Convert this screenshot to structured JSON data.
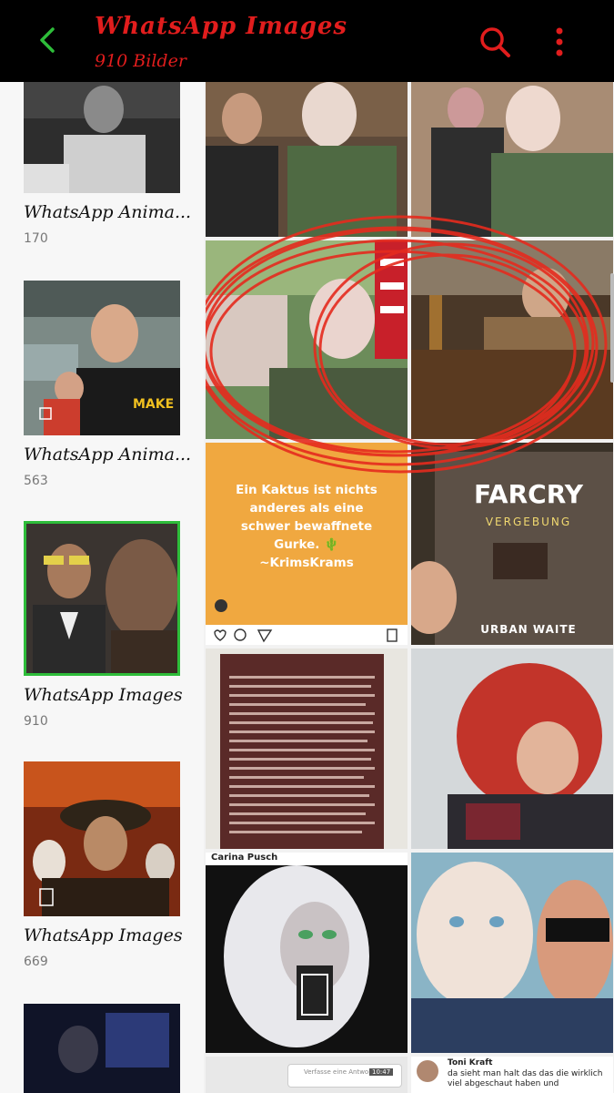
{
  "header": {
    "title": "WhatsApp Images",
    "subtitle": "910 Bilder",
    "accent_color": "#e11d1d"
  },
  "albums": [
    {
      "name": "WhatsApp Anima...",
      "count": "170"
    },
    {
      "name": "WhatsApp Anima...",
      "count": "563"
    },
    {
      "name": "WhatsApp Images",
      "count": "910"
    },
    {
      "name": "WhatsApp Images",
      "count": "669"
    }
  ],
  "grid": {
    "kaktus_text": "Ein Kaktus ist nichts anderes als eine schwer bewaffnete Gurke. 🌵 ~KrimsKrams",
    "farcry_title": "FARCRY",
    "farcry_subtitle": "VERGEBUNG",
    "farcry_author": "URBAN WAITE",
    "carina_label": "Carina Pusch",
    "comment_name": "Toni Kraft",
    "comment_text": "da sieht man halt das das die wirklich viel abgeschaut haben und",
    "reply_placeholder": "Verfasse eine Antwort...",
    "reply_time": "10:47"
  }
}
